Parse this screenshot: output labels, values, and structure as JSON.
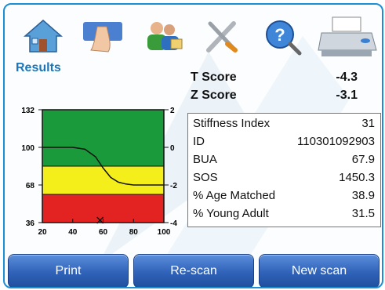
{
  "toolbar": {
    "icons": [
      "home-icon",
      "patient-icon",
      "users-icon",
      "tools-icon",
      "help-icon",
      "printer-icon"
    ]
  },
  "results_title": "Results",
  "scores": {
    "t_label": "T Score",
    "t_value": "-4.3",
    "z_label": "Z Score",
    "z_value": "-3.1"
  },
  "details": [
    {
      "label": "Stiffness Index",
      "value": "31"
    },
    {
      "label": "ID",
      "value": "110301092903"
    },
    {
      "label": "BUA",
      "value": "67.9"
    },
    {
      "label": "SOS",
      "value": "1450.3"
    },
    {
      "label": "% Age Matched",
      "value": "38.9"
    },
    {
      "label": "% Young Adult",
      "value": "31.5"
    }
  ],
  "buttons": {
    "print": "Print",
    "rescan": "Re-scan",
    "new_scan": "New scan"
  },
  "colors": {
    "green": "#1a9a3a",
    "yellow": "#f4ef1a",
    "red": "#e32222",
    "accent": "#1b8fd6"
  },
  "chart_data": {
    "type": "line",
    "x_ticks": [
      20,
      40,
      60,
      80,
      100
    ],
    "y_left_ticks": [
      36,
      68,
      100,
      132
    ],
    "y_right_ticks": [
      -4,
      -2,
      0,
      2
    ],
    "xlim": [
      20,
      100
    ],
    "ylim": [
      36,
      132
    ],
    "bands": [
      {
        "color": "green",
        "from": -1,
        "to": 2
      },
      {
        "color": "yellow",
        "from": -2.5,
        "to": -1
      },
      {
        "color": "red",
        "from": -4,
        "to": -2.5
      }
    ],
    "curve": {
      "x": [
        20,
        30,
        40,
        48,
        55,
        60,
        65,
        70,
        75,
        80,
        90,
        100
      ],
      "y": [
        0,
        0,
        0,
        -0.1,
        -0.5,
        -1.1,
        -1.6,
        -1.85,
        -1.95,
        -2.0,
        -2.0,
        -2.0
      ]
    },
    "marker": {
      "x": 58,
      "y": -4
    }
  }
}
